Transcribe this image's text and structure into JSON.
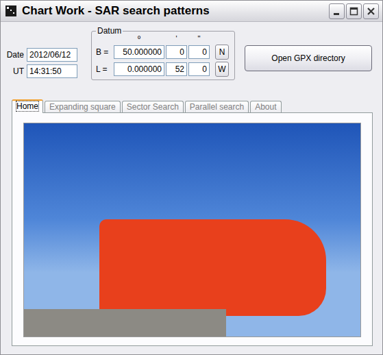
{
  "window": {
    "title": "Chart Work - SAR search patterns"
  },
  "date": {
    "label": "Date",
    "value": "2012/06/12"
  },
  "ut": {
    "label": "UT",
    "value": "14:31:50"
  },
  "datum": {
    "title": "Datum",
    "headers": [
      "º",
      "'",
      "\""
    ],
    "rows": [
      {
        "label": "B =",
        "degrees": "50.000000",
        "minutes": "0",
        "seconds": "0",
        "hemisphere": "N"
      },
      {
        "label": "L =",
        "degrees": "0.000000",
        "minutes": "52",
        "seconds": "0",
        "hemisphere": "W"
      }
    ]
  },
  "open_button": {
    "label": "Open GPX directory"
  },
  "tabs": [
    {
      "label": "Home",
      "selected": true
    },
    {
      "label": "Expanding square",
      "selected": false
    },
    {
      "label": "Sector Search",
      "selected": false
    },
    {
      "label": "Parallel search",
      "selected": false
    },
    {
      "label": "About",
      "selected": false
    }
  ]
}
